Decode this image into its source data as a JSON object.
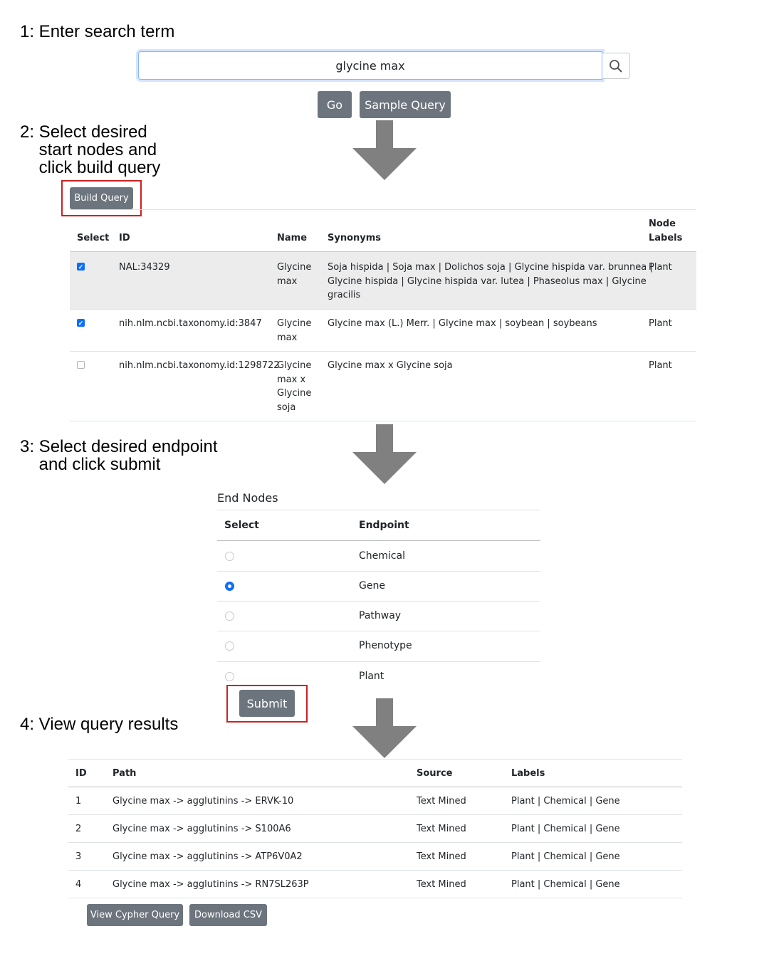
{
  "steps": {
    "s1": "1: Enter search term",
    "s2": "2: Select desired\n    start nodes and\n    click build query",
    "s3": "3: Select desired endpoint\n    and click submit",
    "s4": "4: View query results"
  },
  "search": {
    "value": "glycine max",
    "go": "Go",
    "sample": "Sample Query",
    "icon": "search-icon"
  },
  "build_query": "Build Query",
  "start_table": {
    "headers": {
      "select": "Select",
      "id": "ID",
      "name": "Name",
      "synonyms": "Synonyms",
      "node_labels_1": "Node",
      "node_labels_2": "Labels"
    },
    "rows": [
      {
        "checked": true,
        "id": "NAL:34329",
        "name": [
          "Glycine",
          "max"
        ],
        "synonyms": [
          "Soja hispida | Soja max | Dolichos soja | Glycine hispida var. brunnea |",
          "Glycine hispida | Glycine hispida var. lutea | Phaseolus max | Glycine",
          "gracilis"
        ],
        "label": "Plant"
      },
      {
        "checked": true,
        "id": "nih.nlm.ncbi.taxonomy.id:3847",
        "name": [
          "Glycine",
          "max"
        ],
        "synonyms": [
          "Glycine max (L.) Merr. | Glycine max | soybean | soybeans"
        ],
        "label": "Plant"
      },
      {
        "checked": false,
        "id": "nih.nlm.ncbi.taxonomy.id:1298722",
        "name": [
          "Glycine",
          "max x",
          "Glycine",
          "soja"
        ],
        "synonyms": [
          "Glycine max x Glycine soja"
        ],
        "label": "Plant"
      }
    ]
  },
  "end_nodes": {
    "title": "End Nodes",
    "headers": {
      "select": "Select",
      "endpoint": "Endpoint"
    },
    "options": [
      "Chemical",
      "Gene",
      "Pathway",
      "Phenotype",
      "Plant"
    ],
    "selected": "Gene",
    "submit": "Submit"
  },
  "results": {
    "headers": {
      "id": "ID",
      "path": "Path",
      "source": "Source",
      "labels": "Labels"
    },
    "rows": [
      {
        "id": "1",
        "path": "Glycine max -> agglutinins -> ERVK-10",
        "source": "Text Mined",
        "labels": "Plant | Chemical | Gene"
      },
      {
        "id": "2",
        "path": "Glycine max -> agglutinins -> S100A6",
        "source": "Text Mined",
        "labels": "Plant | Chemical | Gene"
      },
      {
        "id": "3",
        "path": "Glycine max -> agglutinins -> ATP6V0A2",
        "source": "Text Mined",
        "labels": "Plant | Chemical | Gene"
      },
      {
        "id": "4",
        "path": "Glycine max -> agglutinins -> RN7SL263P",
        "source": "Text Mined",
        "labels": "Plant | Chemical | Gene"
      }
    ],
    "view_cypher": "View Cypher Query",
    "download_csv": "Download CSV"
  },
  "colors": {
    "button": "#6c757d",
    "highlight_box": "#cc2222",
    "arrow": "#808080",
    "checked": "#0d6efd",
    "row_striped": "#ececec"
  }
}
